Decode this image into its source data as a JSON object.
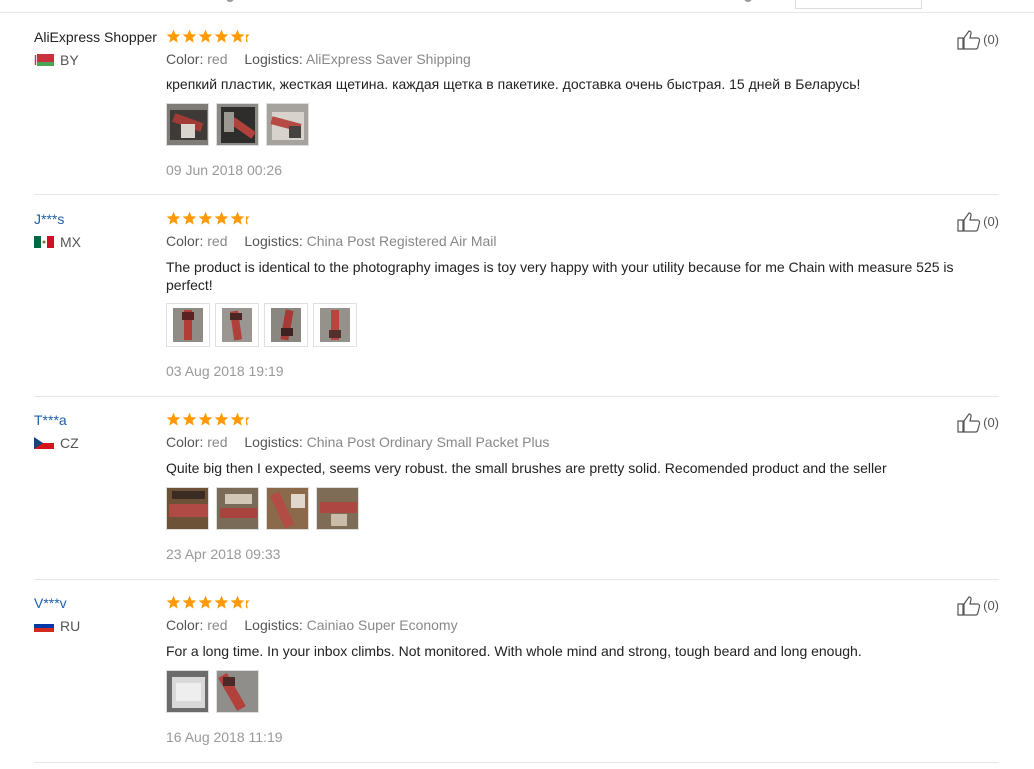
{
  "colors": {
    "star": "#ff9a00",
    "link": "#1f5ea8",
    "border": "#e6e6e6",
    "muted": "#999999"
  },
  "reviews": [
    {
      "user": "AliExpress Shopper",
      "country_code": "BY",
      "flag": "belarus-flag",
      "rating": 5,
      "color_label": "Color:",
      "color_value": "red",
      "logistics_label": "Logistics:",
      "logistics_value": "AliExpress Saver Shipping",
      "text": "крепкий пластик, жесткая щетина. каждая щетка в пакетике. доставка очень быстрая. 15 дней в Беларусь!",
      "photo_count": 3,
      "date": "09 Jun 2018 00:26",
      "helpful_count": "(0)"
    },
    {
      "user": "J***s",
      "country_code": "MX",
      "flag": "mexico-flag",
      "rating": 5,
      "color_label": "Color:",
      "color_value": "red",
      "logistics_label": "Logistics:",
      "logistics_value": "China Post Registered Air Mail",
      "text": "The product is identical to the photography images is toy very happy with your utility because for me Chain with measure 525 is perfect!",
      "photo_count": 4,
      "date": "03 Aug 2018 19:19",
      "helpful_count": "(0)"
    },
    {
      "user": "T***a",
      "country_code": "CZ",
      "flag": "czech-flag",
      "rating": 5,
      "color_label": "Color:",
      "color_value": "red",
      "logistics_label": "Logistics:",
      "logistics_value": "China Post Ordinary Small Packet Plus",
      "text": "Quite big then I expected, seems very robust. the small brushes are pretty solid. Recomended product and the seller",
      "photo_count": 4,
      "date": "23 Apr 2018 09:33",
      "helpful_count": "(0)"
    },
    {
      "user": "V***v",
      "country_code": "RU",
      "flag": "russia-flag",
      "rating": 5,
      "color_label": "Color:",
      "color_value": "red",
      "logistics_label": "Logistics:",
      "logistics_value": "Cainiao Super Economy",
      "text": "For a long time. In your inbox climbs. Not monitored. With whole mind and strong, tough beard and long enough.",
      "photo_count": 2,
      "date": "16 Aug 2018 11:19",
      "helpful_count": "(0)"
    }
  ]
}
